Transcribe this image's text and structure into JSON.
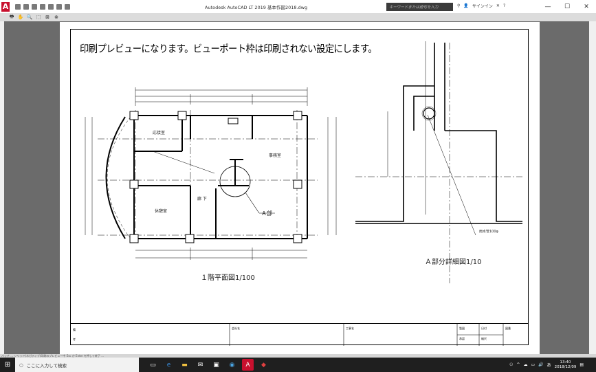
{
  "window": {
    "title": "Autodesk AutoCAD LT 2019    基本作図2018.dwg",
    "app_letter": "A",
    "search_placeholder": "キーワードまたは語句を入力",
    "signin_label": "サインイン",
    "minimize": "—",
    "maximize": "☐",
    "close": "✕"
  },
  "page_note": "印刷プレビューになります。ビューポート枠は印刷されない設定にします。",
  "captions": {
    "plan": "１階平面図1/100",
    "detail": "Ａ部分詳細図1/10",
    "a_part": "Ａ部",
    "rooms": [
      "応接室",
      "事務室",
      "休憩室",
      "廊 下"
    ],
    "pipe": "雨水管100φ"
  },
  "title_block": {
    "left_top": "備",
    "left_bottom": "考",
    "company": "会社名",
    "project": "工事名",
    "drawn": "製図",
    "date": "日付",
    "check": "承認",
    "scale": "縮尺",
    "drawing_no": "図番"
  },
  "statusline": "バッチ … ソリッド(ネガティブ)印刷のプレビュー中  Esc か Enter を押して終了 …",
  "taskbar": {
    "search_placeholder": "ここに入力して検索",
    "clock_time": "13:40",
    "clock_date": "2018/12/09",
    "ime": "あ"
  }
}
